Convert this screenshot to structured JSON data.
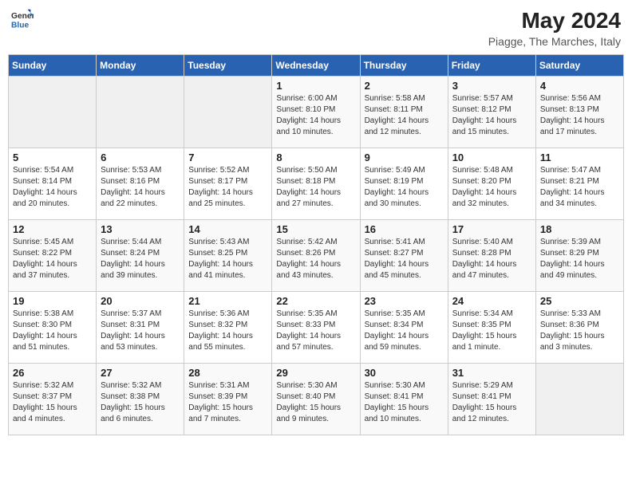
{
  "header": {
    "logo_general": "General",
    "logo_blue": "Blue",
    "month_year": "May 2024",
    "location": "Piagge, The Marches, Italy"
  },
  "weekdays": [
    "Sunday",
    "Monday",
    "Tuesday",
    "Wednesday",
    "Thursday",
    "Friday",
    "Saturday"
  ],
  "weeks": [
    [
      {
        "day": "",
        "info": ""
      },
      {
        "day": "",
        "info": ""
      },
      {
        "day": "",
        "info": ""
      },
      {
        "day": "1",
        "info": "Sunrise: 6:00 AM\nSunset: 8:10 PM\nDaylight: 14 hours\nand 10 minutes."
      },
      {
        "day": "2",
        "info": "Sunrise: 5:58 AM\nSunset: 8:11 PM\nDaylight: 14 hours\nand 12 minutes."
      },
      {
        "day": "3",
        "info": "Sunrise: 5:57 AM\nSunset: 8:12 PM\nDaylight: 14 hours\nand 15 minutes."
      },
      {
        "day": "4",
        "info": "Sunrise: 5:56 AM\nSunset: 8:13 PM\nDaylight: 14 hours\nand 17 minutes."
      }
    ],
    [
      {
        "day": "5",
        "info": "Sunrise: 5:54 AM\nSunset: 8:14 PM\nDaylight: 14 hours\nand 20 minutes."
      },
      {
        "day": "6",
        "info": "Sunrise: 5:53 AM\nSunset: 8:16 PM\nDaylight: 14 hours\nand 22 minutes."
      },
      {
        "day": "7",
        "info": "Sunrise: 5:52 AM\nSunset: 8:17 PM\nDaylight: 14 hours\nand 25 minutes."
      },
      {
        "day": "8",
        "info": "Sunrise: 5:50 AM\nSunset: 8:18 PM\nDaylight: 14 hours\nand 27 minutes."
      },
      {
        "day": "9",
        "info": "Sunrise: 5:49 AM\nSunset: 8:19 PM\nDaylight: 14 hours\nand 30 minutes."
      },
      {
        "day": "10",
        "info": "Sunrise: 5:48 AM\nSunset: 8:20 PM\nDaylight: 14 hours\nand 32 minutes."
      },
      {
        "day": "11",
        "info": "Sunrise: 5:47 AM\nSunset: 8:21 PM\nDaylight: 14 hours\nand 34 minutes."
      }
    ],
    [
      {
        "day": "12",
        "info": "Sunrise: 5:45 AM\nSunset: 8:22 PM\nDaylight: 14 hours\nand 37 minutes."
      },
      {
        "day": "13",
        "info": "Sunrise: 5:44 AM\nSunset: 8:24 PM\nDaylight: 14 hours\nand 39 minutes."
      },
      {
        "day": "14",
        "info": "Sunrise: 5:43 AM\nSunset: 8:25 PM\nDaylight: 14 hours\nand 41 minutes."
      },
      {
        "day": "15",
        "info": "Sunrise: 5:42 AM\nSunset: 8:26 PM\nDaylight: 14 hours\nand 43 minutes."
      },
      {
        "day": "16",
        "info": "Sunrise: 5:41 AM\nSunset: 8:27 PM\nDaylight: 14 hours\nand 45 minutes."
      },
      {
        "day": "17",
        "info": "Sunrise: 5:40 AM\nSunset: 8:28 PM\nDaylight: 14 hours\nand 47 minutes."
      },
      {
        "day": "18",
        "info": "Sunrise: 5:39 AM\nSunset: 8:29 PM\nDaylight: 14 hours\nand 49 minutes."
      }
    ],
    [
      {
        "day": "19",
        "info": "Sunrise: 5:38 AM\nSunset: 8:30 PM\nDaylight: 14 hours\nand 51 minutes."
      },
      {
        "day": "20",
        "info": "Sunrise: 5:37 AM\nSunset: 8:31 PM\nDaylight: 14 hours\nand 53 minutes."
      },
      {
        "day": "21",
        "info": "Sunrise: 5:36 AM\nSunset: 8:32 PM\nDaylight: 14 hours\nand 55 minutes."
      },
      {
        "day": "22",
        "info": "Sunrise: 5:35 AM\nSunset: 8:33 PM\nDaylight: 14 hours\nand 57 minutes."
      },
      {
        "day": "23",
        "info": "Sunrise: 5:35 AM\nSunset: 8:34 PM\nDaylight: 14 hours\nand 59 minutes."
      },
      {
        "day": "24",
        "info": "Sunrise: 5:34 AM\nSunset: 8:35 PM\nDaylight: 15 hours\nand 1 minute."
      },
      {
        "day": "25",
        "info": "Sunrise: 5:33 AM\nSunset: 8:36 PM\nDaylight: 15 hours\nand 3 minutes."
      }
    ],
    [
      {
        "day": "26",
        "info": "Sunrise: 5:32 AM\nSunset: 8:37 PM\nDaylight: 15 hours\nand 4 minutes."
      },
      {
        "day": "27",
        "info": "Sunrise: 5:32 AM\nSunset: 8:38 PM\nDaylight: 15 hours\nand 6 minutes."
      },
      {
        "day": "28",
        "info": "Sunrise: 5:31 AM\nSunset: 8:39 PM\nDaylight: 15 hours\nand 7 minutes."
      },
      {
        "day": "29",
        "info": "Sunrise: 5:30 AM\nSunset: 8:40 PM\nDaylight: 15 hours\nand 9 minutes."
      },
      {
        "day": "30",
        "info": "Sunrise: 5:30 AM\nSunset: 8:41 PM\nDaylight: 15 hours\nand 10 minutes."
      },
      {
        "day": "31",
        "info": "Sunrise: 5:29 AM\nSunset: 8:41 PM\nDaylight: 15 hours\nand 12 minutes."
      },
      {
        "day": "",
        "info": ""
      }
    ]
  ]
}
